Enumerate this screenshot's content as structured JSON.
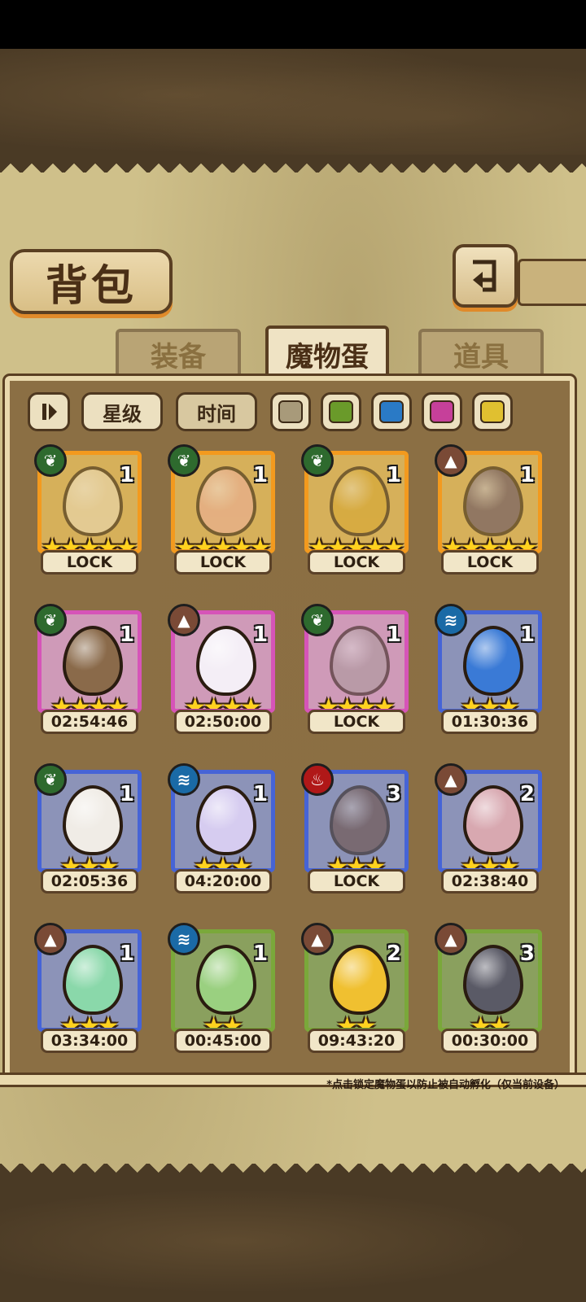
{
  "title": "背包",
  "tabs": [
    {
      "label": "装备",
      "active": false
    },
    {
      "label": "魔物蛋",
      "active": true
    },
    {
      "label": "道具",
      "active": false
    }
  ],
  "filters": {
    "sort_star": "星级",
    "sort_time": "时间",
    "swatches": [
      "#a89a7a",
      "#6a9a2a",
      "#2a7ac6",
      "#c6409a",
      "#e0c030"
    ]
  },
  "note": "*点击锁定魔物蛋以防止被自动孵化（仅当前设备）",
  "element_icons": {
    "grass": "leaf-icon",
    "earth": "mountain-icon",
    "water": "wave-icon",
    "fire": "flame-icon"
  },
  "eggs": [
    {
      "element": "grass",
      "count": "1",
      "stars": 5,
      "label": "LOCK",
      "rarity": "gold",
      "color": "#efe0c0"
    },
    {
      "element": "grass",
      "count": "1",
      "stars": 5,
      "label": "LOCK",
      "rarity": "gold",
      "color": "#f0b0a0"
    },
    {
      "element": "grass",
      "count": "1",
      "stars": 5,
      "label": "LOCK",
      "rarity": "gold",
      "color": "#d8a830"
    },
    {
      "element": "earth",
      "count": "1",
      "stars": 5,
      "label": "LOCK",
      "rarity": "gold",
      "color": "#5a4a6a"
    },
    {
      "element": "grass",
      "count": "1",
      "stars": 4,
      "label": "02:54:46",
      "rarity": "pink",
      "color": "#8a6a4a"
    },
    {
      "element": "earth",
      "count": "1",
      "stars": 4,
      "label": "02:50:00",
      "rarity": "pink",
      "color": "#f4eef6"
    },
    {
      "element": "grass",
      "count": "1",
      "stars": 4,
      "label": "LOCK",
      "rarity": "pink",
      "color": "#a89a9a"
    },
    {
      "element": "water",
      "count": "1",
      "stars": 3,
      "label": "01:30:36",
      "rarity": "blue",
      "color": "#3a7ad6"
    },
    {
      "element": "grass",
      "count": "1",
      "stars": 3,
      "label": "02:05:36",
      "rarity": "blue",
      "color": "#f0ece6"
    },
    {
      "element": "water",
      "count": "1",
      "stars": 3,
      "label": "04:20:00",
      "rarity": "blue",
      "color": "#d6ccf0"
    },
    {
      "element": "fire",
      "count": "3",
      "stars": 3,
      "label": "LOCK",
      "rarity": "blue",
      "color": "#6a4a3a"
    },
    {
      "element": "earth",
      "count": "2",
      "stars": 3,
      "label": "02:38:40",
      "rarity": "blue",
      "color": "#d8a8b0"
    },
    {
      "element": "earth",
      "count": "1",
      "stars": 3,
      "label": "03:34:00",
      "rarity": "blue",
      "color": "#8ad8aa"
    },
    {
      "element": "water",
      "count": "1",
      "stars": 2,
      "label": "00:45:00",
      "rarity": "green",
      "color": "#9ad080"
    },
    {
      "element": "earth",
      "count": "2",
      "stars": 2,
      "label": "09:43:20",
      "rarity": "green",
      "color": "#f0c030"
    },
    {
      "element": "earth",
      "count": "3",
      "stars": 2,
      "label": "00:30:00",
      "rarity": "green",
      "color": "#5a5a66"
    }
  ]
}
